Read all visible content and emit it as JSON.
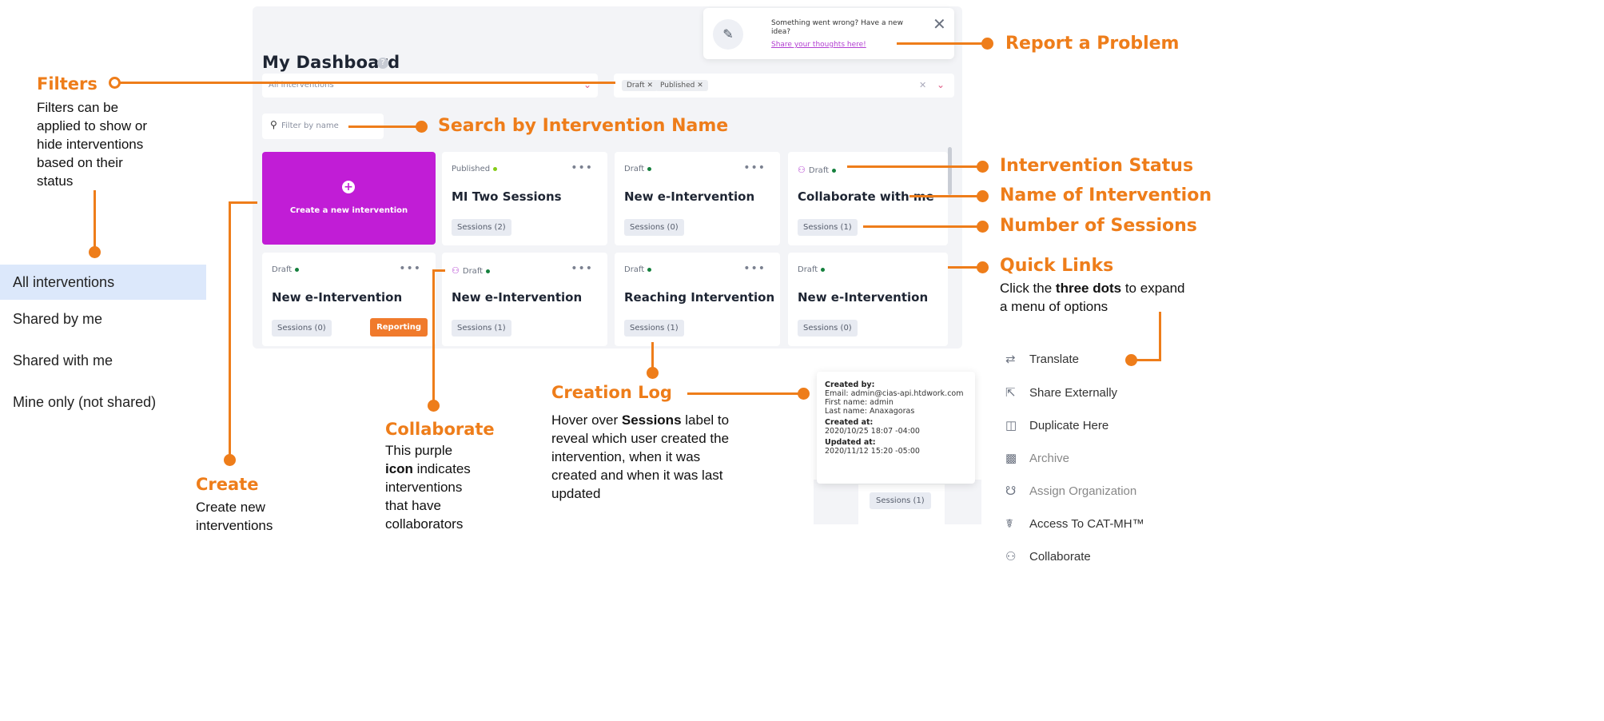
{
  "dashboard": {
    "title": "My Dashboard",
    "filter_placeholder": "All interventions",
    "status_chips": [
      "Draft",
      "Published"
    ],
    "search_placeholder": "Filter by name",
    "create_label": "Create a new intervention",
    "report": {
      "text": "Something went wrong? Have a new idea?",
      "link": "Share your thoughts here!"
    },
    "cards": [
      {
        "status": "Published",
        "name": "MI Two Sessions",
        "sessions": "Sessions (2)",
        "collab": false
      },
      {
        "status": "Draft",
        "name": "New e-Intervention",
        "sessions": "Sessions (0)",
        "collab": false
      },
      {
        "status": "Draft",
        "name": "Collaborate with me",
        "sessions": "Sessions (1)",
        "collab": true
      },
      {
        "status": "Draft",
        "name": "New e-Intervention",
        "sessions": "Sessions (0)",
        "collab": false,
        "reporting": "Reporting"
      },
      {
        "status": "Draft",
        "name": "New e-Intervention",
        "sessions": "Sessions (1)",
        "collab": true
      },
      {
        "status": "Draft",
        "name": "Reaching Intervention",
        "sessions": "Sessions (1)",
        "collab": false
      },
      {
        "status": "Draft",
        "name": "New e-Intervention",
        "sessions": "Sessions (0)",
        "collab": false
      }
    ]
  },
  "filter_options": [
    "All interventions",
    "Shared by me",
    "Shared with me",
    "Mine only (not shared)"
  ],
  "annotations": {
    "filters_title": "Filters",
    "filters_body": [
      "Filters can be",
      "applied to show or",
      "hide interventions",
      "based on their",
      "status"
    ],
    "search": "Search by Intervention Name",
    "report": "Report a Problem",
    "status": "Intervention Status",
    "name": "Name of Intervention",
    "sessions": "Number of Sessions",
    "quick_title": "Quick Links",
    "quick_body_pre": "Click the ",
    "quick_body_bold": "three dots",
    "quick_body_post": " to expand",
    "quick_body_line2": "a menu of options",
    "create_title": "Create",
    "create_body": [
      "Create new",
      "interventions"
    ],
    "collab_title": "Collaborate",
    "collab_body_1": "This purple",
    "collab_body_bold": "icon",
    "collab_body_2": " indicates",
    "collab_body_rest": [
      "interventions",
      "that have",
      "collaborators"
    ],
    "log_title": "Creation Log",
    "log_body_pre": "Hover over ",
    "log_body_bold": "Sessions",
    "log_body_post": " label to",
    "log_body_rest": [
      "reveal which user created the",
      "intervention, when it was",
      "created and when it was last",
      "updated"
    ]
  },
  "creation_log": {
    "created_by_label": "Created by:",
    "email": "Email: admin@cias-api.htdwork.com",
    "first_name": "First name: admin",
    "last_name": "Last name: Anaxagoras",
    "created_at_label": "Created at:",
    "created_at": "2020/10/25 18:07 -04:00",
    "updated_at_label": "Updated at:",
    "updated_at": "2020/11/12 15:20 -05:00",
    "sessions": "Sessions (1)"
  },
  "quick_links": [
    {
      "label": "Translate",
      "icon": "translate-icon"
    },
    {
      "label": "Share Externally",
      "icon": "share-icon"
    },
    {
      "label": "Duplicate Here",
      "icon": "duplicate-icon"
    },
    {
      "label": "Archive",
      "icon": "archive-icon"
    },
    {
      "label": "Assign Organization",
      "icon": "organization-icon"
    },
    {
      "label": "Access To CAT-MH™",
      "icon": "cat-mh-icon"
    },
    {
      "label": "Collaborate",
      "icon": "collaborate-icon"
    }
  ],
  "colors": {
    "accent": "#ee7d1a",
    "create_card": "#c11dd6",
    "collab_icon": "#b23fd1"
  }
}
